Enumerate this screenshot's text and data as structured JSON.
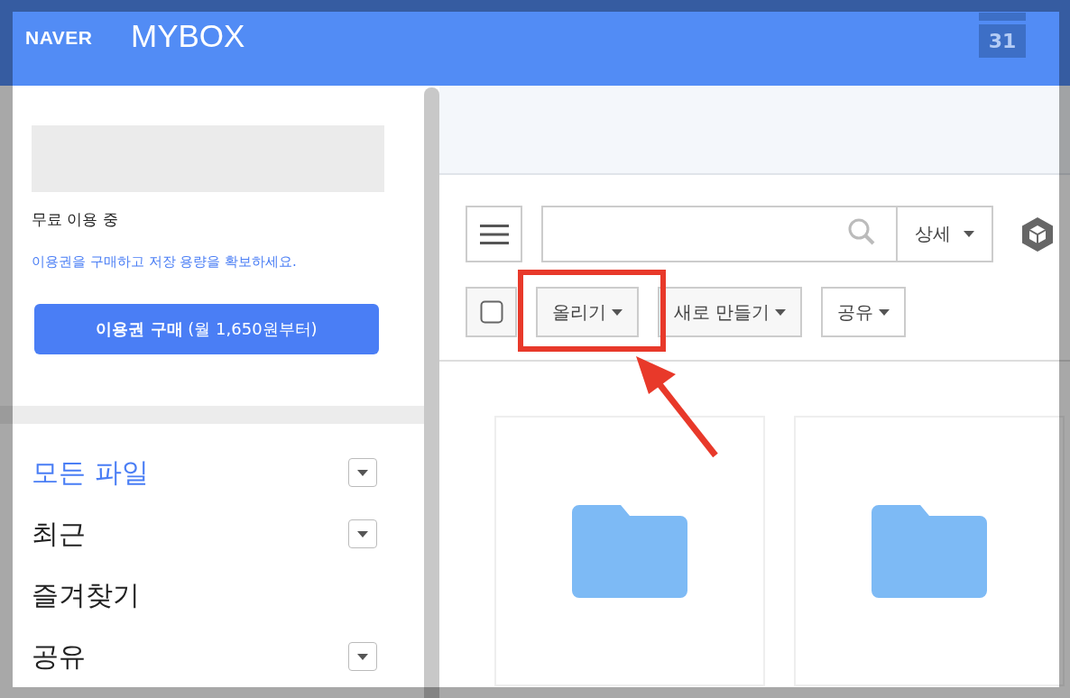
{
  "header": {
    "brand": "NAVER",
    "product": "MYBOX",
    "calendar_day": "31"
  },
  "sidebar": {
    "plan_status": "무료 이용 중",
    "plan_hint": "이용권을 구매하고 저장 용량을 확보하세요.",
    "buy_button": "**이용권 구매** (월 1,650원부터)",
    "items": [
      {
        "label": "모든 파일",
        "selected": true,
        "has_dropdown": true
      },
      {
        "label": "최근",
        "selected": false,
        "has_dropdown": true
      },
      {
        "label": "즐겨찾기",
        "selected": false,
        "has_dropdown": false
      },
      {
        "label": "공유",
        "selected": false,
        "has_dropdown": true
      }
    ]
  },
  "toolbar": {
    "select_all_checked": false,
    "detail_button": "상세",
    "actions": [
      {
        "label": "올리기",
        "highlighted": true
      },
      {
        "label": "새로 만들기",
        "highlighted": false
      },
      {
        "label": "공유",
        "highlighted": false
      }
    ]
  },
  "folders": [
    {
      "kind": "folder"
    },
    {
      "kind": "folder"
    }
  ]
}
